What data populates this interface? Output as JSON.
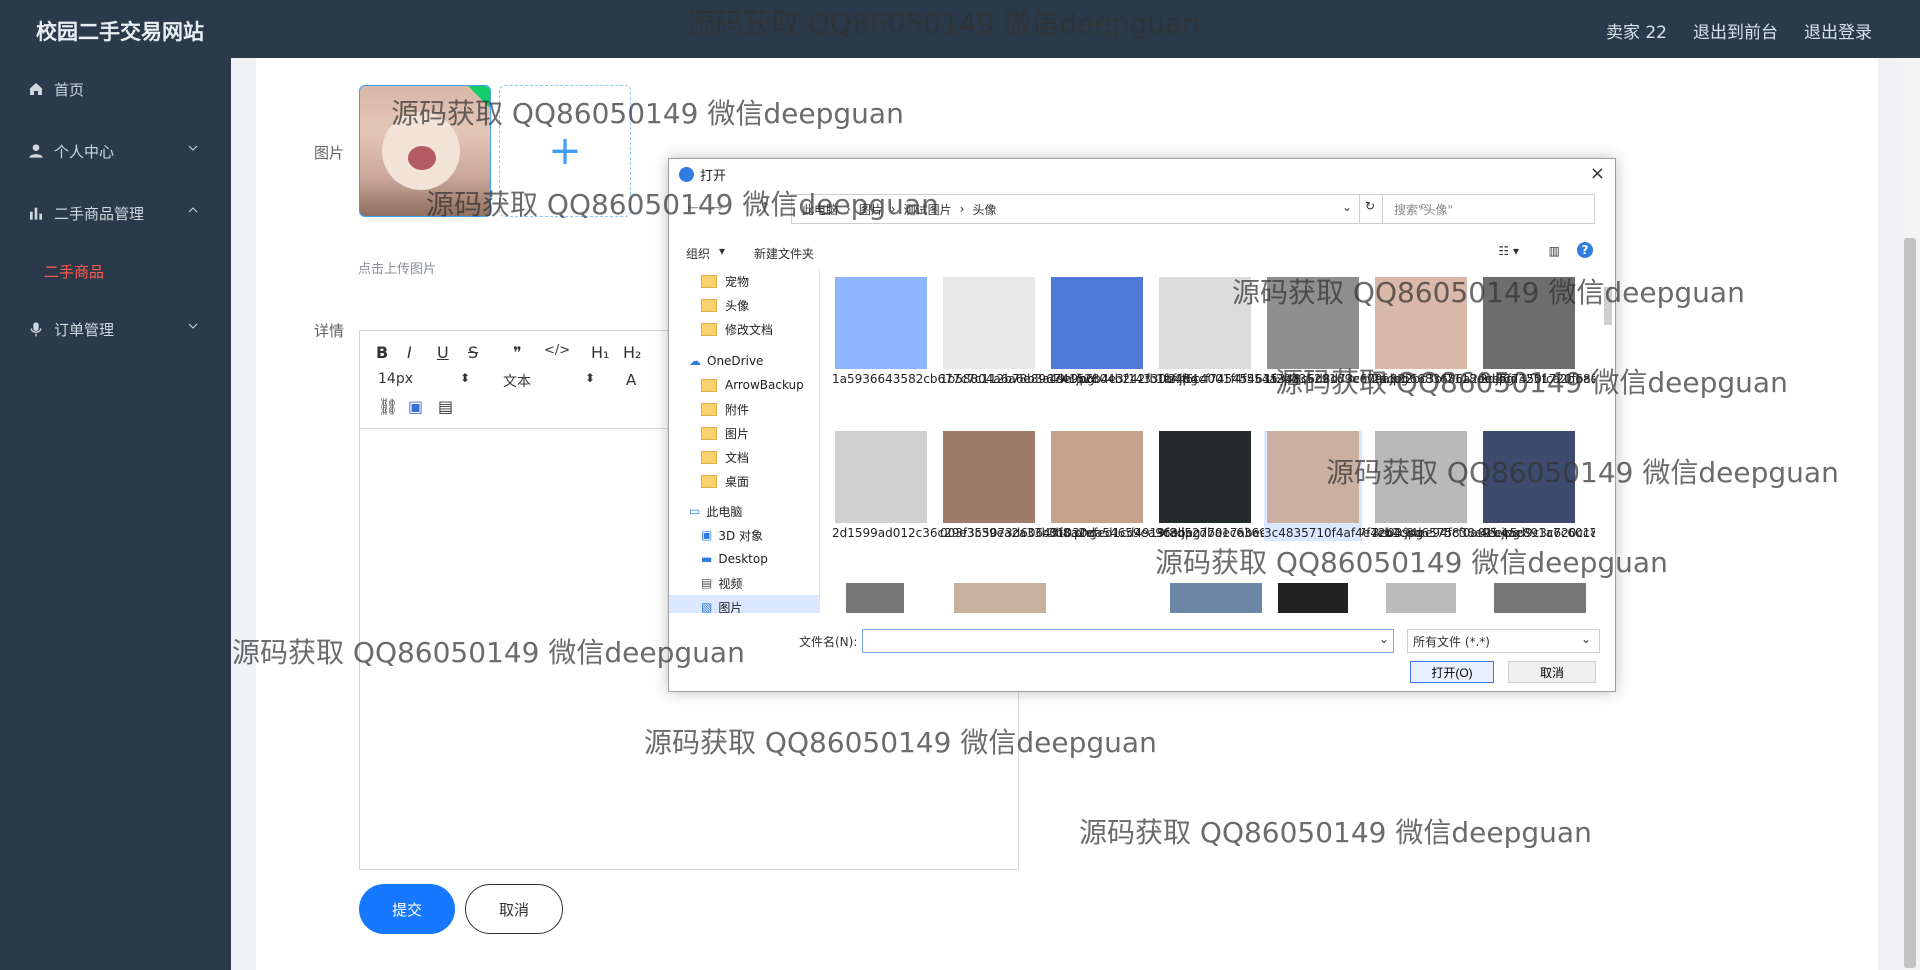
{
  "app": {
    "title": "校园二手交易网站"
  },
  "top_nav": {
    "user": "卖家 22",
    "links": [
      "退出到前台",
      "退出登录"
    ]
  },
  "sidebar": {
    "items": [
      {
        "label": "首页",
        "icon": "home-icon"
      },
      {
        "label": "个人中心",
        "icon": "user-icon"
      },
      {
        "label": "二手商品管理",
        "icon": "chart-icon"
      },
      {
        "label": "二手商品",
        "icon": ""
      },
      {
        "label": "订单管理",
        "icon": "mic-icon"
      }
    ]
  },
  "form": {
    "image_label": "图片",
    "upload_tip": "点击上传图片",
    "details_label": "详情",
    "font_size": "14px",
    "text_style": "文本",
    "submit": "提交",
    "cancel": "取消"
  },
  "dialog": {
    "title": "打开",
    "breadcrumb": [
      "此电脑",
      "图片",
      "测试图片",
      "头像"
    ],
    "search_placeholder": "搜索\"头像\"",
    "toolbar_organize": "组织",
    "toolbar_new_folder": "新建文件夹",
    "tree": [
      "宠物",
      "头像",
      "修改文档",
      "OneDrive",
      "ArrowBackup",
      "附件",
      "图片",
      "文档",
      "桌面",
      "此电脑",
      "3D 对象",
      "Desktop",
      "视频",
      "图片"
    ],
    "files": [
      {
        "name": "1a5936643582cb677c7c112b78b3a49a.jpg",
        "color": "#8db6ff"
      },
      {
        "name": "1b58804a6a6e89674152804b242fb1af.jpg",
        "color": "#e8e8e8"
      },
      {
        "name": "1de9b6b4e3f14330b4f6c4001f4f554a.jpg",
        "color": "#4f7ad7"
      },
      {
        "name": "1f2484cf745454635348c6d8d73ce09f.jpg",
        "color": "#dcdcdc"
      },
      {
        "name": "1f2033529189e67aa822bc3bf7118de.jpg",
        "color": "#8f8f8f"
      },
      {
        "name": "2adeb6683686a2ece5f7450fca2d68e3.jpeg",
        "color": "#d9b9a9"
      },
      {
        "name": "2d86d3251720fba94e32bef4f300332c.jpg",
        "color": "#6d6d6d"
      },
      {
        "name": "2d1599ad012c36c29e355073d60643f8.png",
        "color": "#cfcfcf"
      },
      {
        "name": "003f3c39ea2a33b01030da54659ea96e.jpg",
        "color": "#9d7d69"
      },
      {
        "name": "3b8a2efed1cd4919f8d52770e7abec1c.jpg",
        "color": "#c4a28b"
      },
      {
        "name": "3c3becdba1c63695026924837127f42b4.jpg",
        "color": "#252a2d"
      },
      {
        "name": "3c4835710f4af4e7cb1c8d6575838e95.jpg",
        "color": "#c9b0a0"
      },
      {
        "name": "3e0394ee94fcf0a01b4ae891a7c60189.jpg",
        "color": "#b9b9b9"
      },
      {
        "name": "4eee5d9c3c620cc7125200e0985c63b.jpg",
        "color": "#3c4b6e"
      }
    ],
    "filename_label": "文件名(N):",
    "filename_value": "",
    "filetype": "所有文件 (*.*)",
    "open": "打开(O)",
    "cancel": "取消"
  },
  "watermark": "源码获取 QQ86050149 微信deepguan"
}
